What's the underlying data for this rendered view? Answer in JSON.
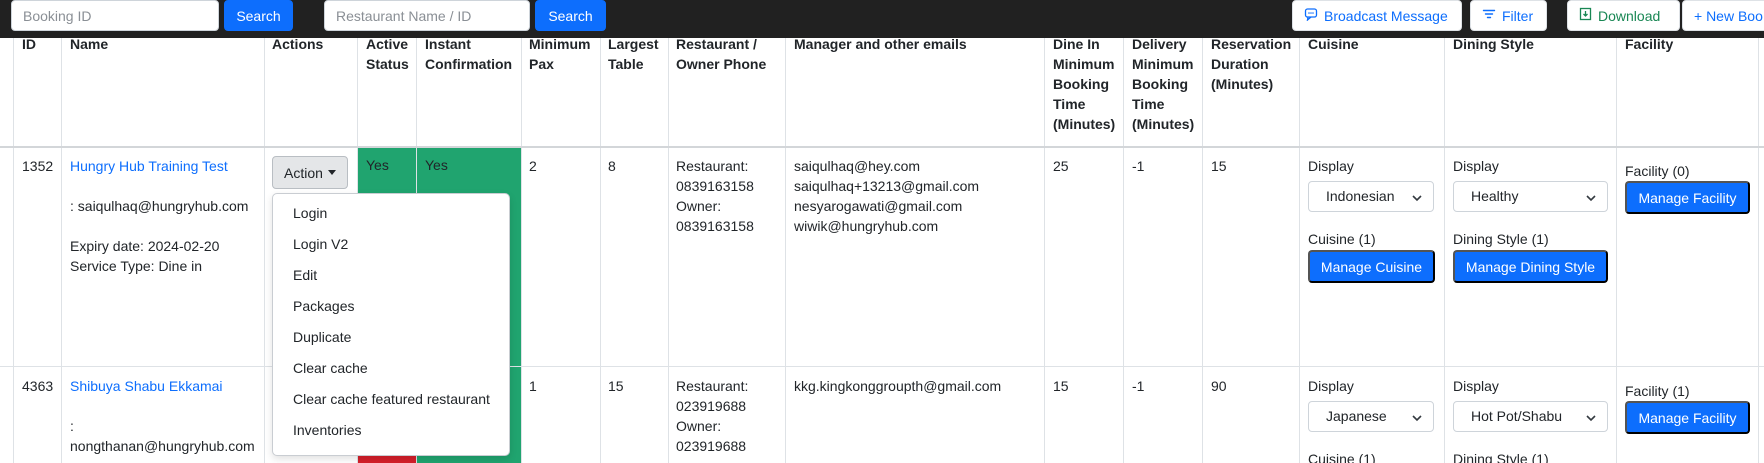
{
  "toolbar": {
    "booking_placeholder": "Booking ID",
    "search_label": "Search",
    "restaurant_placeholder": "Restaurant Name / ID",
    "search2_label": "Search",
    "broadcast_label": "Broadcast Message",
    "filter_label": "Filter",
    "download_label": "Download",
    "new_booking_label": "+ New Boo"
  },
  "table": {
    "headers": {
      "id": "ID",
      "name": "Name",
      "actions": "Actions",
      "active_status": [
        "Active",
        "Status"
      ],
      "instant_confirmation": [
        "Instant",
        "Confirmation"
      ],
      "minimum_pax": [
        "Minimum",
        "Pax"
      ],
      "largest_table": [
        "Largest",
        "Table"
      ],
      "phone": [
        "Restaurant /",
        "Owner Phone"
      ],
      "emails": "Manager and other emails",
      "dine_in": [
        "Dine In",
        "Minimum",
        "Booking",
        "Time",
        "(Minutes)"
      ],
      "delivery": [
        "Delivery",
        "Minimum",
        "Booking",
        "Time",
        "(Minutes)"
      ],
      "reservation": [
        "Reservation",
        "Duration",
        "(Minutes)"
      ],
      "cuisine": "Cuisine",
      "dining_style": "Dining Style",
      "facility": "Facility"
    },
    "rows": [
      {
        "id": "1352",
        "name": "Hungry Hub Training Test",
        "owner_line": ": saiqulhaq@hungryhub.com",
        "expiry": "Expiry date: 2024-02-20",
        "service": "Service Type: Dine in",
        "action_label": "Action",
        "active_status": "Yes",
        "instant_confirmation": "Yes",
        "min_pax": "2",
        "largest_table": "8",
        "phone": [
          "Restaurant:",
          "0839163158",
          "Owner:",
          "0839163158"
        ],
        "emails": [
          "saiqulhaq@hey.com",
          "saiqulhaq+13213@gmail.com",
          "nesyarogawati@gmail.com",
          "wiwik@hungryhub.com"
        ],
        "dine_in": "25",
        "delivery": "-1",
        "reservation": "15",
        "cuisine_display_label": "Display",
        "cuisine_value": "Indonesian",
        "cuisine_count": "Cuisine (1)",
        "manage_cuisine": "Manage Cuisine",
        "dining_display_label": "Display",
        "dining_value": "Healthy",
        "dining_count": "Dining Style (1)",
        "manage_dining": "Manage Dining Style",
        "facility_count": "Facility (0)",
        "manage_facility": "Manage Facility"
      },
      {
        "id": "4363",
        "name": "Shibuya Shabu Ekkamai",
        "owner_line_1": ":",
        "owner_line_2": "nongthanan@hungryhub.com",
        "phone": [
          "Restaurant:",
          "023919688",
          "Owner:",
          "023919688"
        ],
        "min_pax": "1",
        "largest_table": "15",
        "emails": [
          "kkg.kingkonggroupth@gmail.com"
        ],
        "dine_in": "15",
        "delivery": "-1",
        "reservation": "90",
        "cuisine_display_label": "Display",
        "cuisine_value": "Japanese",
        "cuisine_count": "Cuisine (1)",
        "dining_display_label": "Display",
        "dining_value": "Hot Pot/Shabu",
        "dining_count": "Dining Style (1)",
        "facility_count": "Facility (1)",
        "manage_facility": "Manage Facility"
      }
    ]
  },
  "action_menu": [
    "Login",
    "Login V2",
    "Edit",
    "Packages",
    "Duplicate",
    "Clear cache",
    "Clear cache featured restaurant",
    "Inventories"
  ],
  "colors": {
    "topbar": "#212121",
    "primary": "#0d6efd",
    "status_green": "#20a46f",
    "status_red": "#d51f2a",
    "download_green": "#198754"
  },
  "icons": {
    "broadcast": "broadcast-icon",
    "filter": "filter-icon",
    "download": "download-icon",
    "caret": "caret-down-icon",
    "select": "chevron-down-icon"
  }
}
